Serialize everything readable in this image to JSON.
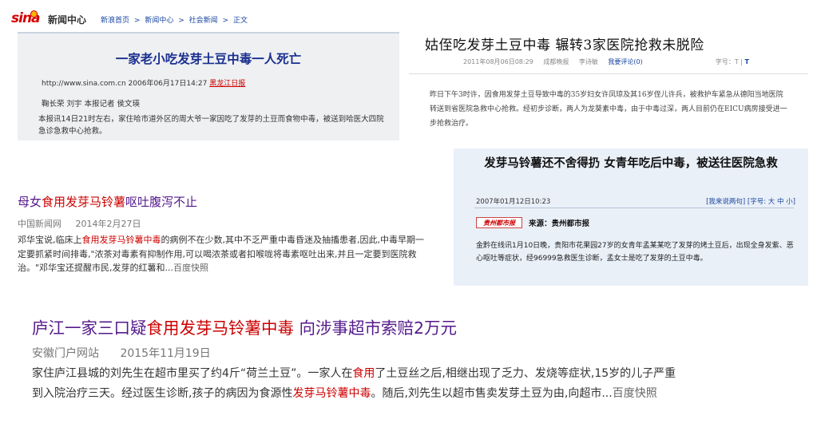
{
  "colors": {
    "link_purple": "#551a8b",
    "highlight_red": "#c00000",
    "sina_red": "#d40000",
    "link_blue": "#1a47a0"
  },
  "sina": {
    "logo_text": "sina",
    "site_name": "新闻中心",
    "breadcrumb": [
      "新浪首页",
      ">",
      "新闻中心",
      ">",
      "社会新闻",
      ">",
      "正文"
    ],
    "headline": "一家老小吃发芽土豆中毒一人死亡",
    "url_date": "http://www.sina.com.cn 2006年06月17日14:27",
    "source": "黑龙江日报",
    "authors": "鞠长荣 刘宇 本报记者 侯文瑛",
    "body": "本报讯14日21时左右，家住哈市道外区的周大爷一家因吃了发芽的土豆而食物中毒，被送到哈医大四院急诊急救中心抢救。"
  },
  "article2": {
    "title": "姑侄吃发芽土豆中毒  辗转3家医院抢救未脱险",
    "date": "2011年08月06日08:29",
    "paper": "成都晚报",
    "author": "李诗敏",
    "comment": "我要评论(0)",
    "font_label": "字号：",
    "font_t1": "T",
    "font_sep": " | ",
    "font_t2": "T",
    "body": "昨日下午3时许，因食用发芽土豆导致中毒的35岁妇女许凤琼及其16岁侄儿许兵，被救护车紧急从德阳当地医院转送到省医院急救中心抢救。经初步诊断，两人为龙葵素中毒，由于中毒过深，两人目前仍在EICU病房接受进一步抢救治疗。"
  },
  "result3": {
    "title_pre": "母女",
    "title_hl": "食用发芽马铃薯",
    "title_post": "呕吐腹泻不止",
    "source": "中国新闻网",
    "date": "2014年2月27日",
    "body_pre": "邓华宝说,临床上",
    "body_hl": "食用发芽马铃薯中毒",
    "body_post": "的病例不在少数,其中不乏严重中毒昏迷及抽搐患者,因此,中毒早期一定要抓紧时间排毒,\"浓茶对毒素有抑制作用,可以喝浓茶或者扣喉咙将毒素呕吐出来,并且一定要到医院救治。\"邓华宝还提醒市民,发芽的红薯和...",
    "snapshot": "百度快照"
  },
  "article4": {
    "title": "发芽马铃薯还不舍得扔 女青年吃后中毒，被送往医院急救",
    "datetime": "2007年01月12日10:23",
    "tools": "[我来说两句] [字号: 大 中 小]",
    "source_logo": "贵州都市报",
    "source": "来源：贵州都市报",
    "body": "金黔在线讯1月10日晚，贵阳市花果园27岁的女青年孟某某吃了发芽的烤土豆后，出现全身发紫、恶心呕吐等症状，经96999急救医生诊断，孟女士是吃了发芽的土豆中毒。"
  },
  "result5": {
    "title_pre": "庐江一家三口疑",
    "title_hl": "食用发芽马铃薯中毒",
    "title_post": " 向涉事超市索赔2万元",
    "source": "安徽门户网站",
    "date": "2015年11月19日",
    "body_a": "家住庐江县城的刘先生在超市里买了约4斤“荷兰土豆”。一家人在",
    "body_hl1": "食用",
    "body_b": "了土豆丝之后,相继出现了乏力、发烧等症状,15岁的儿子严重到入院治疗三天。经过医生诊断,孩子的病因为食源性",
    "body_hl2": "发芽马铃薯中毒",
    "body_c": "。随后,刘先生以超市售卖发芽土豆为由,向超市...",
    "snapshot": "百度快照"
  }
}
